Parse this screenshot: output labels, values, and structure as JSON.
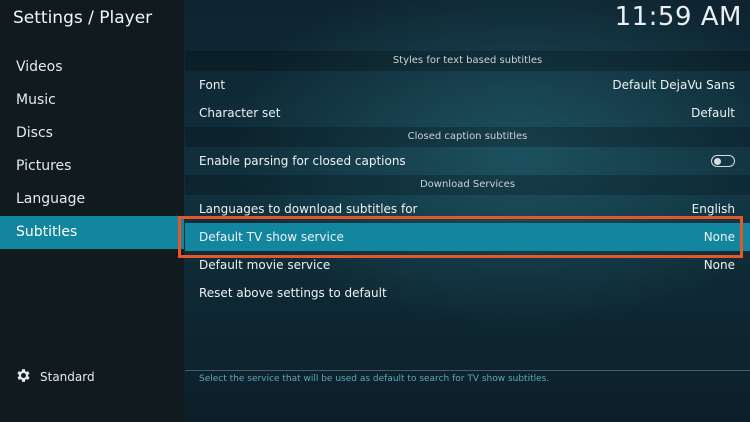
{
  "header": {
    "title": "Settings / Player",
    "clock": "11:59 AM"
  },
  "sidebar": {
    "items": [
      {
        "label": "Videos"
      },
      {
        "label": "Music"
      },
      {
        "label": "Discs"
      },
      {
        "label": "Pictures"
      },
      {
        "label": "Language"
      },
      {
        "label": "Subtitles",
        "active": true
      }
    ],
    "settings_level": {
      "label": "Standard",
      "icon": "gear-icon"
    }
  },
  "settings": {
    "section_text": "Styles for text based subtitles",
    "font": {
      "label": "Font",
      "value": "Default DejaVu Sans"
    },
    "charset": {
      "label": "Character set",
      "value": "Default"
    },
    "section_cc": "Closed caption subtitles",
    "cc_parsing": {
      "label": "Enable parsing for closed captions",
      "enabled": false
    },
    "section_download": "Download Services",
    "languages": {
      "label": "Languages to download subtitles for",
      "value": "English"
    },
    "tv_service": {
      "label": "Default TV show service",
      "value": "None"
    },
    "movie_service": {
      "label": "Default movie service",
      "value": "None"
    },
    "reset": {
      "label": "Reset above settings to default"
    }
  },
  "hint": "Select the service that will be used as default to search for TV show subtitles.",
  "colors": {
    "accent": "#12869f",
    "highlight_border": "#e5572a",
    "hint": "#5ea8bb"
  }
}
